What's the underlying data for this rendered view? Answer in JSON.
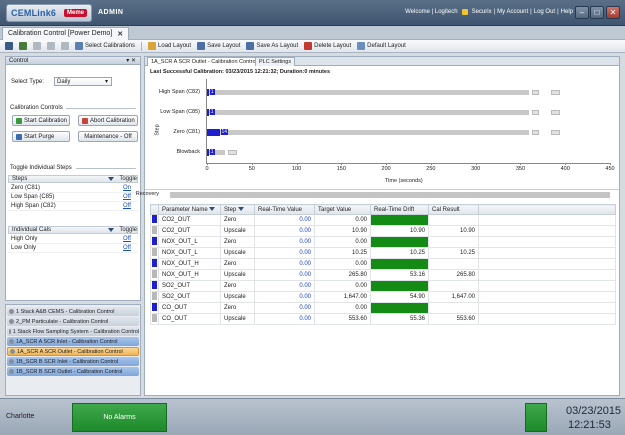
{
  "topbar": {
    "logo_text": "CEMLink6",
    "logo_badge": "Meme",
    "area": "ADMIN",
    "links": [
      "Welcome | Logitech",
      "Securix",
      "My Account",
      "Log Out",
      "Help"
    ]
  },
  "doc_tab": {
    "title": "Calibration Control [Power Demo]",
    "close": "✕"
  },
  "toolbar": {
    "select_calibrations": "Select Calibrations",
    "load_layout": "Load Layout",
    "save_layout": "Save Layout",
    "save_as_layout": "Save As Layout",
    "delete_layout": "Delete Layout",
    "default_layout": "Default Layout"
  },
  "control": {
    "header": "Control",
    "select_type_label": "Select Type:",
    "select_type_value": "Daily",
    "calibration_controls_label": "Calibration Controls",
    "start_calibration": "Start Calibration",
    "abort_calibration": "Abort Calibration",
    "start_purge": "Start Purge",
    "maintenance": "Maintenance - Off",
    "toggle_steps_label": "Toggle Individual Steps",
    "steps_header": "Steps",
    "toggle_header": "Toggle",
    "steps": [
      {
        "name": "Zero (C81)",
        "state": "On"
      },
      {
        "name": "Low Span (C85)",
        "state": "Off"
      },
      {
        "name": "High Span (C82)",
        "state": "Off"
      }
    ],
    "cals_header": "Individual Cals",
    "cals": [
      {
        "name": "High Only",
        "state": "Off"
      },
      {
        "name": "Low Only",
        "state": "Off"
      }
    ]
  },
  "navlist": [
    "1 Stack A&B CEMS - Calibration Control",
    "2_PM Particulate - Calibration Control",
    "1 Stack Flow Sampling System - Calibration Control",
    "1A_SCR A SCR Inlet - Calibration Control",
    "1A_SCR A SCR Outlet - Calibration Control",
    "1B_SCR B SCR Inlet - Calibration Control",
    "1B_SCR B SCR Outlet - Calibration Control"
  ],
  "main_tabs": [
    "1A_SCR A SCR Outlet - Calibration Control",
    "PLC Settings"
  ],
  "last_calibration": "Last Successful Calibration: 03/23/2015 12:21:32;  Duration:0 minutes",
  "chart_data": {
    "type": "bar",
    "ylabel": "Step",
    "xlabel": "Time (seconds)",
    "xlim": [
      0,
      450
    ],
    "xticks": [
      0,
      50,
      100,
      150,
      200,
      250,
      300,
      350,
      400,
      450
    ],
    "categories": [
      "High Span (C82)",
      "Low Span (C85)",
      "Zero (C81)",
      "Blowback",
      "Recovery"
    ],
    "series": [
      {
        "values": [
          360,
          360,
          360,
          20,
          450
        ]
      },
      {
        "values": [
          2,
          2,
          14,
          2,
          0
        ]
      }
    ],
    "data_labels": [
      "1",
      "1",
      "14",
      "1"
    ]
  },
  "table": {
    "headers": [
      "Parameter Name",
      "Step",
      "Real-Time Value",
      "Target Value",
      "Real-Time Drift",
      "Cal Result"
    ],
    "rows": [
      {
        "marker": "#1f1fd0",
        "param": "CO2_OUT",
        "step": "Zero",
        "rtv": "0.00",
        "target": "0.00",
        "drift": "0.00",
        "drift_green": true,
        "result": ""
      },
      {
        "marker": "#b8b8b8",
        "param": "CO2_OUT",
        "step": "Upscale",
        "rtv": "0.00",
        "target": "10.90",
        "drift": "10.90",
        "drift_green": false,
        "result": "10.90"
      },
      {
        "marker": "#1f1fd0",
        "param": "NOX_OUT_L",
        "step": "Zero",
        "rtv": "0.00",
        "target": "0.00",
        "drift": "0.00",
        "drift_green": true,
        "result": ""
      },
      {
        "marker": "#b8b8b8",
        "param": "NOX_OUT_L",
        "step": "Upscale",
        "rtv": "0.00",
        "target": "10.25",
        "drift": "10.25",
        "drift_green": false,
        "result": "10.25"
      },
      {
        "marker": "#1f1fd0",
        "param": "NOX_OUT_H",
        "step": "Zero",
        "rtv": "0.00",
        "target": "0.00",
        "drift": "0.00",
        "drift_green": true,
        "result": ""
      },
      {
        "marker": "#b8b8b8",
        "param": "NOX_OUT_H",
        "step": "Upscale",
        "rtv": "0.00",
        "target": "265.80",
        "drift": "53.16",
        "drift_green": false,
        "result": "265.80"
      },
      {
        "marker": "#1f1fd0",
        "param": "SO2_OUT",
        "step": "Zero",
        "rtv": "0.00",
        "target": "0.00",
        "drift": "0.00",
        "drift_green": true,
        "result": ""
      },
      {
        "marker": "#b8b8b8",
        "param": "SO2_OUT",
        "step": "Upscale",
        "rtv": "0.00",
        "target": "1,647.00",
        "drift": "54.90",
        "drift_green": false,
        "result": "1,647.00"
      },
      {
        "marker": "#1f1fd0",
        "param": "CO_OUT",
        "step": "Zero",
        "rtv": "0.00",
        "target": "0.00",
        "drift": "0.00",
        "drift_green": true,
        "result": ""
      },
      {
        "marker": "#b8b8b8",
        "param": "CO_OUT",
        "step": "Upscale",
        "rtv": "0.00",
        "target": "553.60",
        "drift": "55.36",
        "drift_green": false,
        "result": "553.60"
      }
    ]
  },
  "status": {
    "site": "Charlotte",
    "alarms": "No Alarms",
    "date": "03/23/2015",
    "time": "12:21:53"
  }
}
